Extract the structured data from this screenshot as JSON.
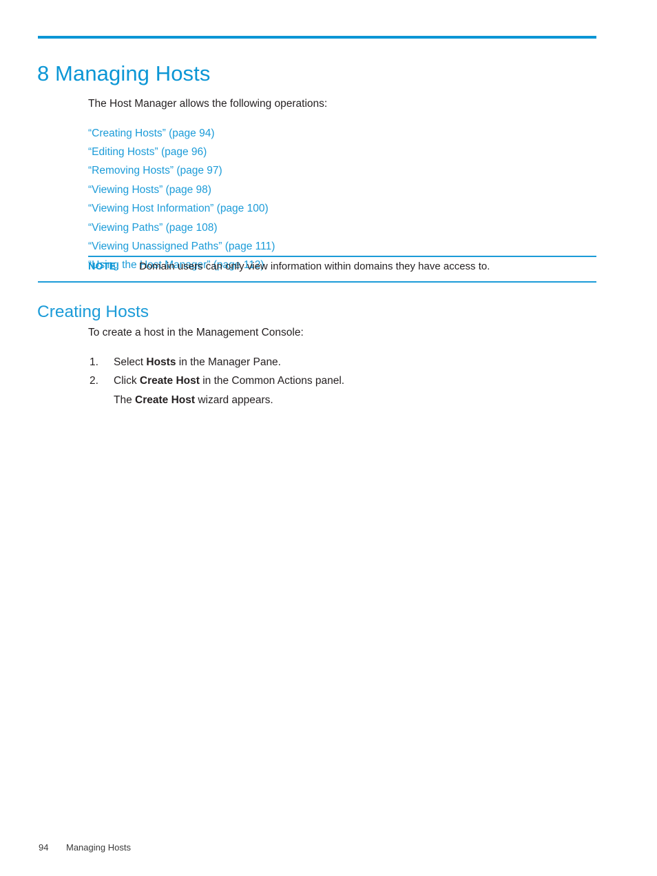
{
  "theme": {
    "accent": "#0b96d5",
    "link": "#1b9bd8",
    "text": "#231f20",
    "background": "#ffffff"
  },
  "chapter": {
    "title": "8 Managing Hosts"
  },
  "intro": {
    "text": "The Host Manager allows the following operations:"
  },
  "cross_references": [
    {
      "label": "“Creating Hosts” (page 94)"
    },
    {
      "label": "“Editing Hosts” (page 96)"
    },
    {
      "label": "“Removing Hosts” (page 97)"
    },
    {
      "label": "“Viewing Hosts” (page 98)"
    },
    {
      "label": "“Viewing Host Information” (page 100)"
    },
    {
      "label": "“Viewing Paths” (page 108)"
    },
    {
      "label": "“Viewing Unassigned Paths” (page 111)"
    },
    {
      "label": "“Using the Host Manager” (page 112)"
    }
  ],
  "note": {
    "label": "NOTE:",
    "text": "Domain users can only view information within domains they have access to."
  },
  "section": {
    "heading": "Creating Hosts",
    "intro": "To create a host in the Management Console:",
    "steps": [
      {
        "number": "1.",
        "parts": [
          {
            "text": "Select ",
            "bold": false
          },
          {
            "text": "Hosts",
            "bold": true
          },
          {
            "text": " in the Manager Pane.",
            "bold": false
          }
        ]
      },
      {
        "number": "2.",
        "parts": [
          {
            "text": "Click ",
            "bold": false
          },
          {
            "text": "Create Host",
            "bold": true
          },
          {
            "text": " in the Common Actions panel.",
            "bold": false
          }
        ],
        "follow_up": [
          {
            "text": "The ",
            "bold": false
          },
          {
            "text": "Create Host",
            "bold": true
          },
          {
            "text": " wizard appears.",
            "bold": false
          }
        ]
      }
    ]
  },
  "footer": {
    "page_number": "94",
    "chapter_name": "Managing Hosts"
  }
}
